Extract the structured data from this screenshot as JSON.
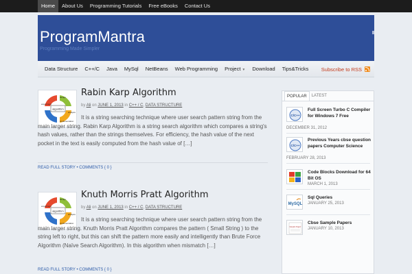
{
  "topnav": {
    "items": [
      "Home",
      "About Us",
      "Programming Tutorials",
      "Free eBooks",
      "Contact Us"
    ]
  },
  "header": {
    "title": "ProgramMantra",
    "tagline": "Programming Made Simpler"
  },
  "mainmenu": {
    "items": [
      "Data Structure",
      "C++/C",
      "Java",
      "MySql",
      "NetBeans",
      "Web Programming",
      "Project",
      "Download",
      "Tips&Tricks"
    ],
    "rss_label": "Subscribe to RSS"
  },
  "posts": [
    {
      "title": "Rabin Karp Algorithm",
      "meta_by": "by",
      "author": "Ali",
      "meta_on": "on",
      "date": "JUNE 1, 2013",
      "meta_in": "in",
      "cat1": "C++ / C",
      "cat2": "DATA STRUCTURE",
      "excerpt": "It is a string searching technique where user search pattern string from the main larger string. Rabin Karp Algorithm is a string search algorithm which compares a string's hash values, rather than the strings themselves. For efficiency, the hash value of the next pocket in the text is easily computed from the hash value of […]",
      "read_more": "READ FULL STORY",
      "comments": "COMMENTS { 0 }",
      "thumb_labels": [
        "design",
        "algorithm",
        "analysis",
        "implementation",
        "experiment"
      ]
    },
    {
      "title": "Knuth Morris Pratt Algorithm",
      "meta_by": "by",
      "author": "Ali",
      "meta_on": "on",
      "date": "JUNE 1, 2013",
      "meta_in": "in",
      "cat1": "C++ / C",
      "cat2": "DATA STRUCTURE",
      "excerpt": "It is a string searching technique where user search pattern string from the main larger string. Knuth Morris Pratt Algorithm compares the pattern ( Small String ) to the string left to right, but this can shift the pattern more easily and intelligently than Brute Force Algorithm (Naïve Search Algorithm). In this algorithm when mismatch […]",
      "read_more": "READ FULL STORY",
      "comments": "COMMENTS { 0 }",
      "thumb_labels": [
        "design",
        "algorithm",
        "analysis",
        "implementation",
        "experiment"
      ]
    }
  ],
  "sidebar": {
    "tabs": [
      "POPULAR",
      "LATEST"
    ],
    "items": [
      {
        "title": "Full Screen Turbo C Compiler for Windows 7 Free",
        "date": "DECEMBER 31, 2012",
        "thumb": "C/C++"
      },
      {
        "title": "Previous Years cbse question papers Computer Science",
        "date": "FEBRUARY 28, 2013",
        "thumb": "C/C++"
      },
      {
        "title": "Code Blocks Download for 64 Bit OS",
        "date": "MARCH 1, 2013",
        "thumb": ""
      },
      {
        "title": "Sql Queries",
        "date": "JANUARY 25, 2013",
        "thumb": "MySQL"
      },
      {
        "title": "Cbse Sample Papers",
        "date": "JANUARY 10, 2013",
        "thumb": "Sample Paper"
      }
    ]
  },
  "colors": {
    "header_bg": "#2e4e98",
    "topnav_bg": "#1c1c1c",
    "link": "#2c5ba8",
    "rss": "#c23a1b"
  }
}
